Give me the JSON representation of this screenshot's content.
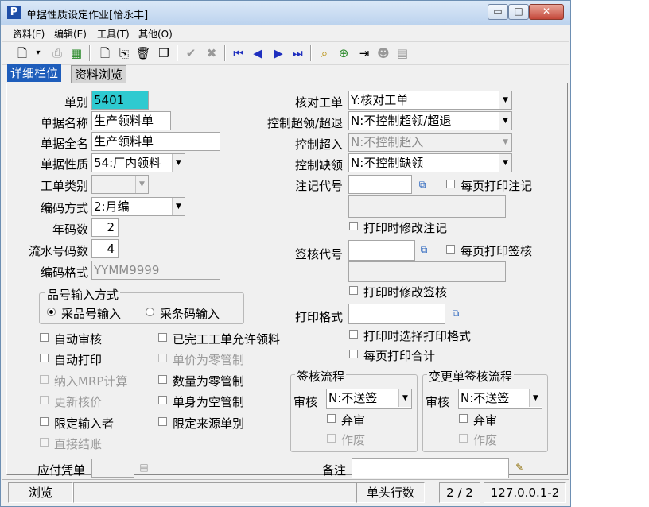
{
  "window": {
    "title": "单据性质设定作业[恰永丰]",
    "app_icon": "P",
    "buttons": [
      "minimize",
      "maximize",
      "close"
    ]
  },
  "menu": [
    "资料(F)",
    "编辑(E)",
    "工具(T)",
    "其他(O)"
  ],
  "toolbar_icons": [
    "print-preview-icon",
    "print-icon",
    "export-excel-icon",
    "new-icon",
    "copy-doc-icon",
    "delete-icon",
    "duplicate-icon",
    "confirm-icon",
    "cancel-icon",
    "first-record-icon",
    "prev-record-icon",
    "next-record-icon",
    "last-record-icon",
    "query-icon",
    "attach-icon",
    "exit-icon",
    "user-icon",
    "message-icon"
  ],
  "tabs": {
    "detail": "详细栏位",
    "browse": "资料浏览"
  },
  "form": {
    "doc_type_label": "单别",
    "doc_type_value": "5401",
    "doc_name_label": "单据名称",
    "doc_name_value": "生产领料单",
    "doc_fullname_label": "单据全名",
    "doc_fullname_value": "生产领料单",
    "doc_nature_label": "单据性质",
    "doc_nature_value": "54:厂内领料",
    "wo_type_label": "工单类别",
    "wo_type_value": "",
    "encode_label": "编码方式",
    "encode_value": "2:月编",
    "year_digits_label": "年码数",
    "year_digits_value": "2",
    "serial_digits_label": "流水号码数",
    "serial_digits_value": "4",
    "format_label": "编码格式",
    "format_value": "YYMM9999",
    "check_wo_label": "核对工单",
    "check_wo_value": "Y:核对工单",
    "over_ctrl_label": "控制超领/超退",
    "over_ctrl_value": "N:不控制超领/超退",
    "over_in_label": "控制超入",
    "over_in_value": "N:不控制超入",
    "short_label": "控制缺领",
    "short_value": "N:不控制缺领",
    "note_code_label": "注记代号",
    "note_code_value": "",
    "sign_code_label": "签核代号",
    "sign_code_value": "",
    "print_fmt_label": "打印格式",
    "print_fmt_value": "",
    "remark_label": "备注",
    "remark_value": "",
    "payable_label": "应付凭单",
    "payable_value": ""
  },
  "item_input": {
    "title": "品号输入方式",
    "opt1": "采品号输入",
    "opt2": "采条码输入",
    "selected": "opt1"
  },
  "checks": {
    "auto_approve": "自动审核",
    "auto_print": "自动打印",
    "mrp": "纳入MRP计算",
    "update_cost": "更新核价",
    "limit_input": "限定输入者",
    "direct_close": "直接结账",
    "done_wo": "已完工工单允许领料",
    "price_zero": "单价为零管制",
    "qty_zero": "数量为零管制",
    "body_empty": "单身为空管制",
    "limit_source": "限定来源单别",
    "print_each_note": "每页打印注记",
    "print_modify_note": "打印时修改注记",
    "print_each_sign": "每页打印签核",
    "print_modify_sign": "打印时修改签核",
    "print_choose_fmt": "打印时选择打印格式",
    "print_each_total": "每页打印合计"
  },
  "sign_flow": {
    "title": "签核流程",
    "approve_label": "审核",
    "approve_value": "N:不送签",
    "abandon": "弃审",
    "void": "作废"
  },
  "change_flow": {
    "title": "变更单签核流程",
    "approve_label": "审核",
    "approve_value": "N:不送签",
    "abandon": "弃审",
    "void": "作废"
  },
  "status": {
    "mode": "浏览",
    "msg": "",
    "rows_label": "单头行数",
    "rows": "2 / 2",
    "host": "127.0.0.1-2"
  }
}
